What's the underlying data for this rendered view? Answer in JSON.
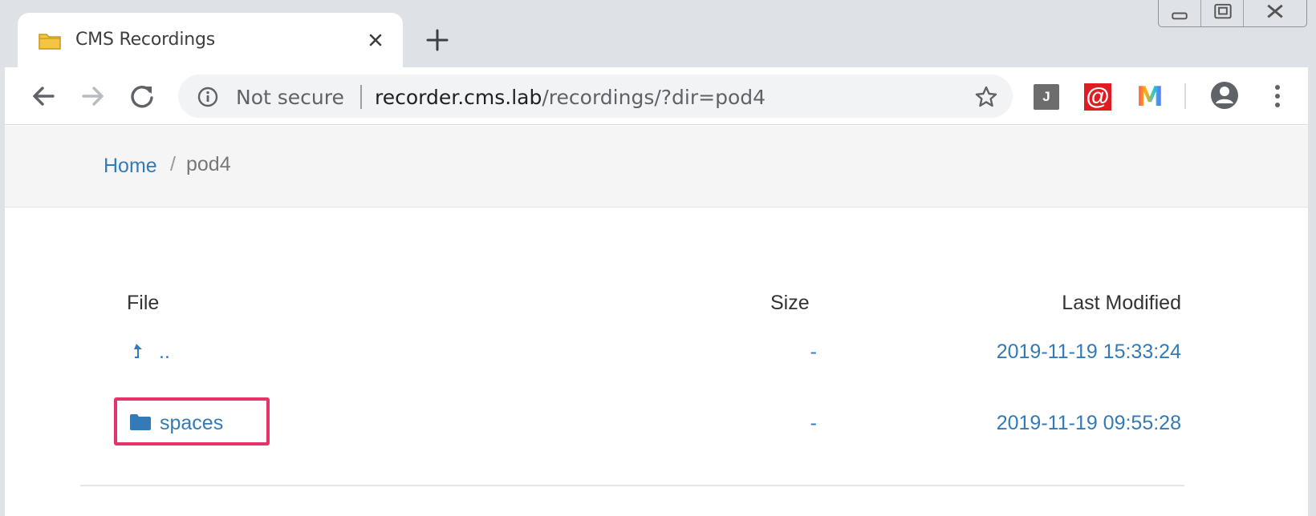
{
  "browser": {
    "tab": {
      "title": "CMS Recordings",
      "icon": "folder-icon"
    },
    "new_tab_icon": "plus-icon",
    "window_controls": [
      "minimize-icon",
      "restore-icon",
      "close-icon"
    ],
    "omnibox": {
      "security_label": "Not secure",
      "url_host": "recorder.cms.lab",
      "url_path": "/recordings/?dir=pod4"
    },
    "extensions": [
      {
        "name": "j-extension-icon",
        "label": "J"
      },
      {
        "name": "at-extension-icon",
        "label": "@"
      },
      {
        "name": "m-extension-icon",
        "label": "M"
      }
    ]
  },
  "page": {
    "breadcrumb": {
      "home": "Home",
      "separator": "/",
      "current": "pod4"
    },
    "table": {
      "headers": {
        "file": "File",
        "size": "Size",
        "modified": "Last Modified"
      },
      "rows": [
        {
          "icon": "level-up-icon",
          "name": "..",
          "size": "-",
          "modified": "2019-11-19 15:33:24"
        },
        {
          "icon": "folder-icon",
          "name": "spaces",
          "size": "-",
          "modified": "2019-11-19 09:55:28"
        }
      ]
    }
  },
  "colors": {
    "link": "#337ab7",
    "highlight_border": "#e8336a",
    "titlebar": "#dee1e6"
  }
}
